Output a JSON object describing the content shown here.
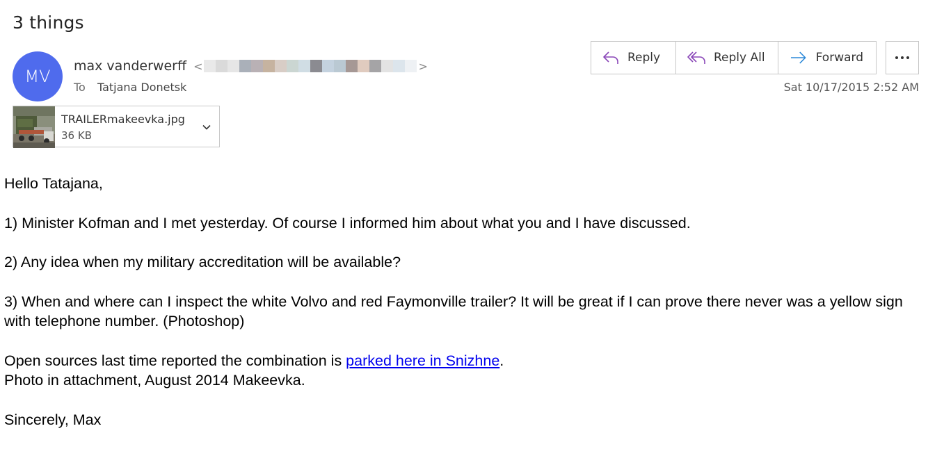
{
  "email": {
    "subject": "3 things",
    "avatar_initials": "MV",
    "avatar_color": "#4f6bed",
    "sender_name": "max vanderwerff",
    "sender_email_open": "<",
    "sender_email_close": ">",
    "to_label": "To",
    "to_name": "Tatjana Donetsk",
    "timestamp": "Sat 10/17/2015 2:52 AM"
  },
  "actions": {
    "reply_label": "Reply",
    "reply_all_label": "Reply All",
    "forward_label": "Forward",
    "more_icon": "ellipsis-icon"
  },
  "attachment": {
    "filename": "TRAILERmakeevka.jpg",
    "size": "36 KB"
  },
  "body": {
    "greeting": "Hello Tatajana,",
    "point1": "1) Minister Kofman and I met yesterday. Of course I informed him about what you and I have discussed.",
    "point2": "2) Any idea when my military accreditation will be available?",
    "point3": "3) When and where can I inspect the white Volvo and red Faymonville trailer? It will be great if I can prove there never was a yellow sign with telephone number. (Photoshop)",
    "sources_prefix": "Open sources last time reported the combination is ",
    "sources_link": "parked here in Snizhne",
    "sources_suffix": ".",
    "photo_line": "Photo in attachment, August 2014 Makeevka.",
    "signature": "Sincerely, Max"
  },
  "colors": {
    "accent_purple": "#8a47b8",
    "forward_blue": "#2b88d8",
    "link": "#0000ee"
  }
}
